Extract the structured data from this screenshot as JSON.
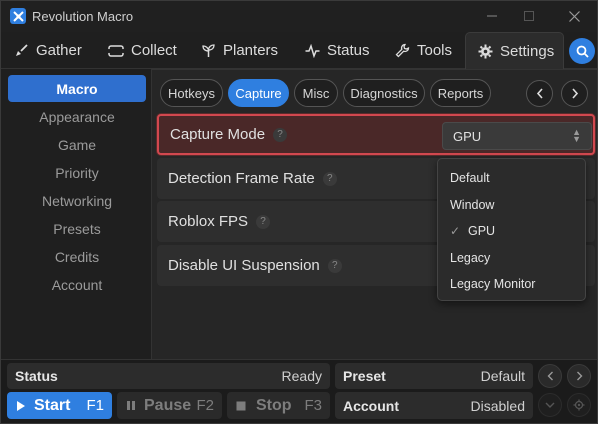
{
  "window": {
    "title": "Revolution Macro"
  },
  "tabs": [
    {
      "label": "Gather",
      "icon": "broom-icon"
    },
    {
      "label": "Collect",
      "icon": "ticket-icon"
    },
    {
      "label": "Planters",
      "icon": "sprout-icon"
    },
    {
      "label": "Status",
      "icon": "activity-icon"
    },
    {
      "label": "Tools",
      "icon": "wrench-icon"
    },
    {
      "label": "Settings",
      "icon": "gear-icon",
      "active": true
    }
  ],
  "sidebar": {
    "items": [
      {
        "label": "Macro",
        "active": true
      },
      {
        "label": "Appearance"
      },
      {
        "label": "Game"
      },
      {
        "label": "Priority"
      },
      {
        "label": "Networking"
      },
      {
        "label": "Presets"
      },
      {
        "label": "Credits"
      },
      {
        "label": "Account"
      }
    ]
  },
  "subtabs": [
    {
      "label": "Hotkeys"
    },
    {
      "label": "Capture",
      "active": true
    },
    {
      "label": "Misc"
    },
    {
      "label": "Diagnostics"
    },
    {
      "label": "Reports"
    }
  ],
  "settings": [
    {
      "label": "Capture Mode",
      "help": "?",
      "value": "GPU"
    },
    {
      "label": "Detection Frame Rate",
      "help": "?"
    },
    {
      "label": "Roblox FPS",
      "help": "?"
    },
    {
      "label": "Disable UI Suspension",
      "help": "?"
    }
  ],
  "dropdown": {
    "options": [
      "Default",
      "Window",
      "GPU",
      "Legacy",
      "Legacy Monitor"
    ],
    "selected": "GPU",
    "check": "✓"
  },
  "footer": {
    "status_label": "Status",
    "status_value": "Ready",
    "preset_label": "Preset",
    "preset_value": "Default",
    "account_label": "Account",
    "account_value": "Disabled",
    "start_label": "Start",
    "start_key": "F1",
    "pause_label": "Pause",
    "pause_key": "F2",
    "stop_label": "Stop",
    "stop_key": "F3"
  },
  "colors": {
    "accent": "#2f7fe0",
    "highlight_border": "#d2484f",
    "highlight_bg": "#4a2828"
  }
}
